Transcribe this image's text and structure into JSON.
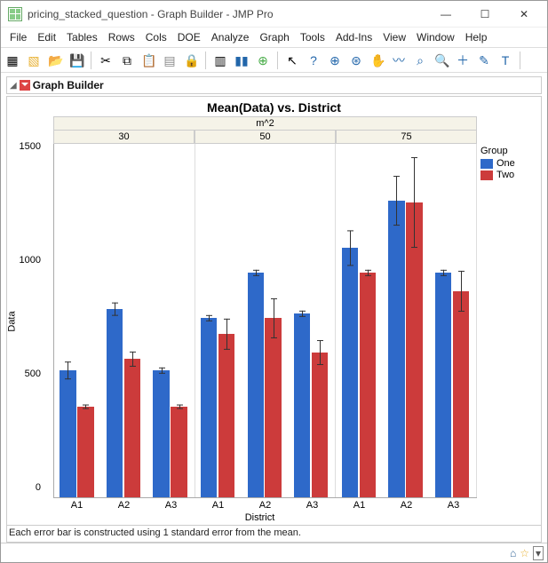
{
  "window": {
    "title": "pricing_stacked_question - Graph Builder - JMP Pro",
    "buttons": {
      "min": "—",
      "max": "☐",
      "close": "✕"
    }
  },
  "menu": [
    "File",
    "Edit",
    "Tables",
    "Rows",
    "Cols",
    "DOE",
    "Analyze",
    "Graph",
    "Tools",
    "Add-Ins",
    "View",
    "Window",
    "Help"
  ],
  "section": {
    "title": "Graph Builder"
  },
  "chart": {
    "title": "Mean(Data) vs. District",
    "panel_var": "m^2",
    "xlabel": "District",
    "ylabel": "Data",
    "footnote": "Each error bar is constructed using 1 standard error from the mean."
  },
  "legend": {
    "title": "Group",
    "items": [
      {
        "name": "One",
        "color": "#2e69c9"
      },
      {
        "name": "Two",
        "color": "#cc3b3b"
      }
    ]
  },
  "chart_data": {
    "type": "bar",
    "panel_variable": "m^2",
    "panels": [
      "30",
      "50",
      "75"
    ],
    "categories": [
      "A1",
      "A2",
      "A3"
    ],
    "series": [
      {
        "name": "One",
        "color": "#2e69c9"
      },
      {
        "name": "Two",
        "color": "#cc3b3b"
      }
    ],
    "ylim": [
      0,
      1560
    ],
    "yticks": [
      0,
      500,
      1000,
      1500
    ],
    "error_note": "±1 standard error",
    "data": {
      "30": {
        "A1": {
          "One": {
            "mean": 560,
            "err": 40
          },
          "Two": {
            "mean": 400,
            "err": 10
          }
        },
        "A2": {
          "One": {
            "mean": 830,
            "err": 30
          },
          "Two": {
            "mean": 610,
            "err": 35
          }
        },
        "A3": {
          "One": {
            "mean": 560,
            "err": 15
          },
          "Two": {
            "mean": 400,
            "err": 10
          }
        }
      },
      "50": {
        "A1": {
          "One": {
            "mean": 790,
            "err": 15
          },
          "Two": {
            "mean": 720,
            "err": 70
          }
        },
        "A2": {
          "One": {
            "mean": 990,
            "err": 15
          },
          "Two": {
            "mean": 790,
            "err": 90
          }
        },
        "A3": {
          "One": {
            "mean": 810,
            "err": 15
          },
          "Two": {
            "mean": 640,
            "err": 55
          }
        }
      },
      "75": {
        "A1": {
          "One": {
            "mean": 1100,
            "err": 80
          },
          "Two": {
            "mean": 990,
            "err": 15
          }
        },
        "A2": {
          "One": {
            "mean": 1310,
            "err": 110
          },
          "Two": {
            "mean": 1300,
            "err": 200
          }
        },
        "A3": {
          "One": {
            "mean": 990,
            "err": 15
          },
          "Two": {
            "mean": 910,
            "err": 90
          }
        }
      }
    }
  }
}
